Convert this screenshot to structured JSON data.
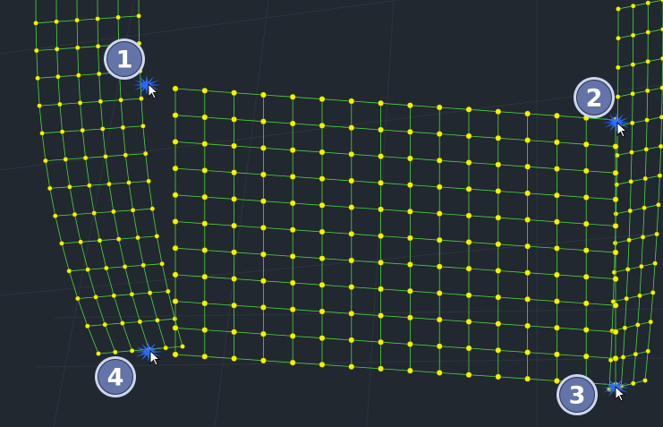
{
  "colors": {
    "background": "#212830",
    "grid": "#2c343d",
    "mesh_line": "#4cd640",
    "node_fill": "#f2f200",
    "node_outline": "#5a5a00",
    "badge_fill": "#6473a8",
    "badge_ring": "#cdd6f0",
    "snap_marker": "#2c6bff"
  },
  "callouts": [
    {
      "label": "1",
      "icon": "cursor-pointer-icon"
    },
    {
      "label": "2",
      "icon": "cursor-pointer-icon"
    },
    {
      "label": "3",
      "icon": "cursor-pointer-icon"
    },
    {
      "label": "4",
      "icon": "cursor-pointer-icon"
    }
  ],
  "mesh": {
    "rows": 11,
    "columns": 16
  }
}
